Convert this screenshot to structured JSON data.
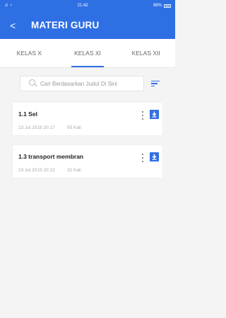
{
  "status_bar": {
    "time": "21:42",
    "battery": "88%"
  },
  "header": {
    "back_label": "<",
    "title": "MATERI GURU"
  },
  "tabs": [
    {
      "label": "KELAS X"
    },
    {
      "label": "KELAS XI"
    },
    {
      "label": "KELAS XII"
    }
  ],
  "search": {
    "placeholder": "Cari Berdasarkan Judul Di Sini"
  },
  "materials": [
    {
      "title": "1.1 Sel",
      "date": "23 Jul 2019 20:17",
      "views": "95 Kali"
    },
    {
      "title": "1.3 transport membran",
      "date": "23 Jul 2019 20:22",
      "views": "32 Kali"
    }
  ],
  "colors": {
    "primary": "#2f6fe4",
    "background": "#f4f4f4"
  },
  "icons": [
    "back-arrow-icon",
    "search-icon",
    "filter-icon",
    "more-vert-icon",
    "download-icon"
  ]
}
